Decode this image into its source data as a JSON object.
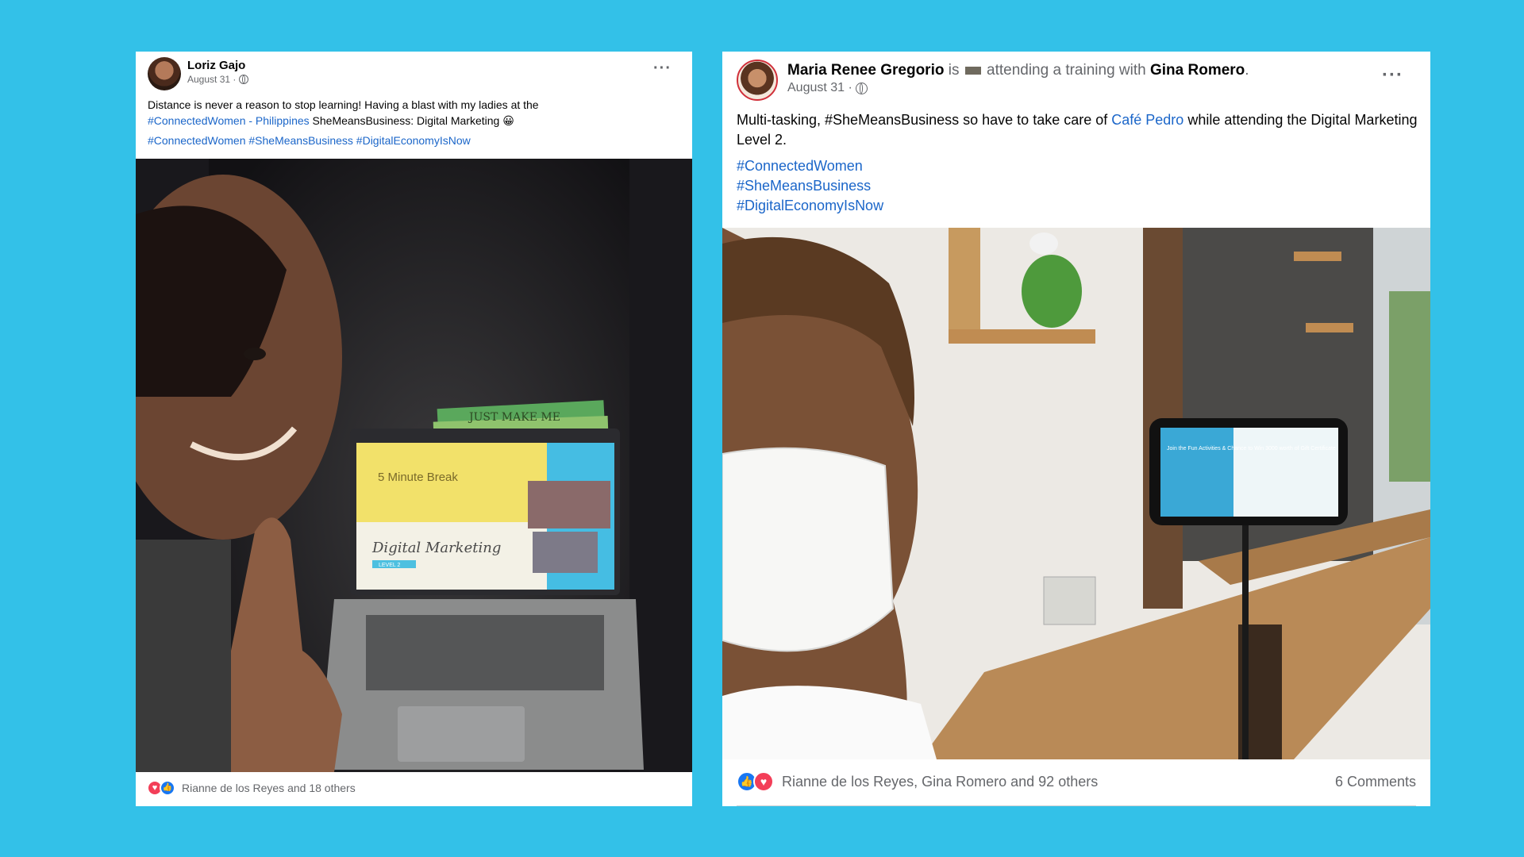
{
  "post1": {
    "author": "Loriz Gajo",
    "date": "August 31 ·",
    "text_line1": "Distance is never a reason to stop learning! Having a blast with my ladies at the",
    "page_link": "#ConnectedWomen - Philippines",
    "text_line2": " SheMeansBusiness: Digital Marketing",
    "emoji": "😀",
    "hashtags": [
      "#ConnectedWomen",
      "#SheMeansBusiness",
      "#DigitalEconomyIsNow"
    ],
    "photo": {
      "screen_title": "5 Minute Break",
      "screen_script": "Digital Marketing",
      "screen_badge": "LEVEL 2",
      "book_text": "JUST MAKE ME"
    },
    "reactions_text": "Rianne de los Reyes and 18 others",
    "reactions": [
      "love",
      "like"
    ]
  },
  "post2": {
    "author": "Maria Renee Gregorio",
    "activity_is": " is ",
    "activity_text": " attending a training with ",
    "tagged_user": "Gina Romero",
    "activity_end": ".",
    "date": "August 31 ·",
    "text_before": "Multi-tasking, #SheMeansBusiness so have to take care of ",
    "page_link": "Café Pedro",
    "text_after": " while attending the Digital Marketing Level 2.",
    "hashtags": [
      "#ConnectedWomen",
      "#SheMeansBusiness",
      "#DigitalEconomyIsNow"
    ],
    "photo": {
      "phone_text": "Join the Fun Activities & Chance to Win 3000 worth of Gift Certificate"
    },
    "reactions_text": "Rianne de los Reyes, Gina Romero and 92 others",
    "comments": "6 Comments",
    "reactions": [
      "like",
      "love"
    ]
  },
  "colors": {
    "background": "#33c1e8",
    "link": "#1b66c9",
    "secondary_text": "#65676b"
  }
}
